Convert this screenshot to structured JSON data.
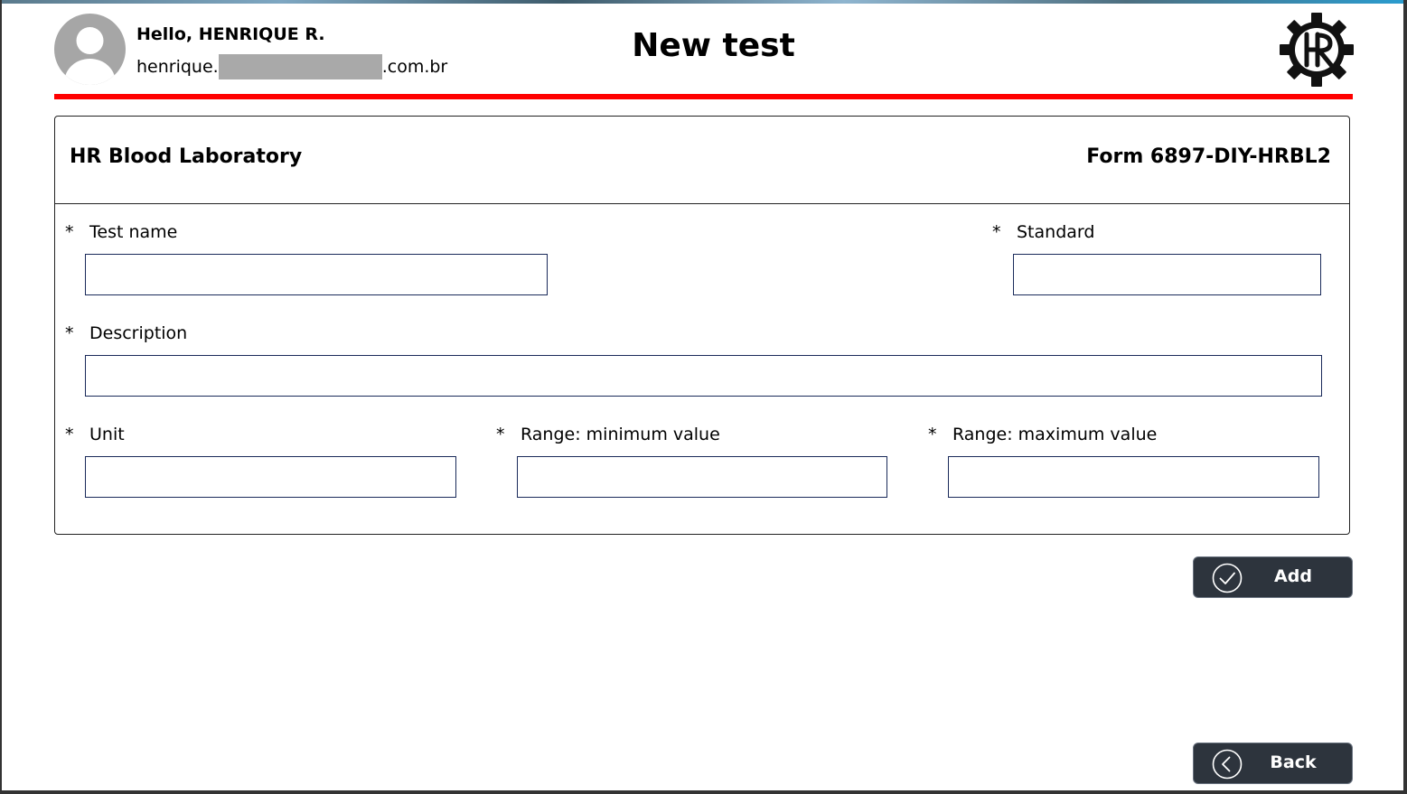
{
  "header": {
    "greeting": "Hello, HENRIQUE R.",
    "email_prefix": "henrique.",
    "email_suffix": ".com.br",
    "title": "New test"
  },
  "card": {
    "lab_name": "HR Blood Laboratory",
    "form_code": "Form 6897-DIY-HRBL2"
  },
  "fields": {
    "required_mark": "*",
    "test_name": {
      "label": "Test name",
      "value": ""
    },
    "standard": {
      "label": "Standard",
      "value": ""
    },
    "description": {
      "label": "Description",
      "value": ""
    },
    "unit": {
      "label": "Unit",
      "value": ""
    },
    "range_min": {
      "label": "Range: minimum value",
      "value": ""
    },
    "range_max": {
      "label": "Range: maximum value",
      "value": ""
    }
  },
  "buttons": {
    "add_label": "Add",
    "back_label": "Back"
  },
  "icons": {
    "avatar": "user-avatar-icon",
    "logo": "hr-gear-logo",
    "add": "check-circle-icon",
    "back": "chevron-left-circle-icon"
  },
  "colors": {
    "accent_line": "#ff0000",
    "button_bg": "#2d343d",
    "input_border": "#1a2a5a",
    "avatar_gray": "#a6a6a6"
  }
}
